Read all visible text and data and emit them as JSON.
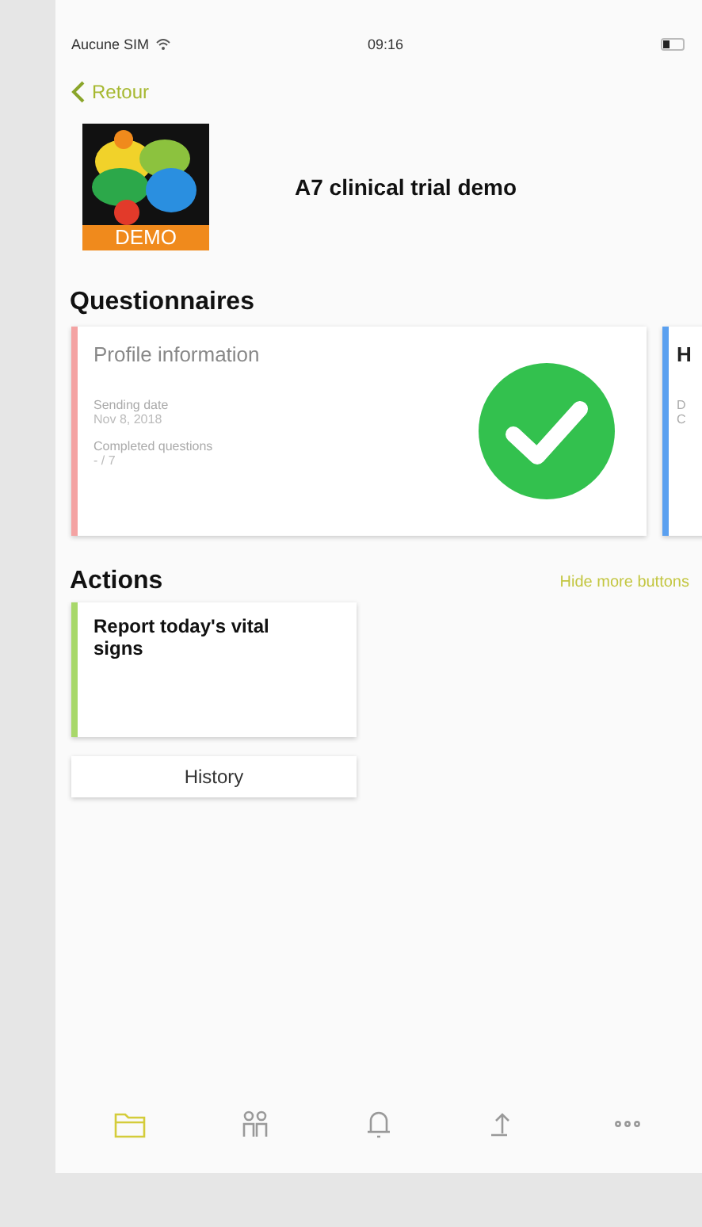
{
  "status_bar": {
    "carrier": "Aucune SIM",
    "time": "09:16"
  },
  "nav": {
    "back": "Retour"
  },
  "study": {
    "title": "A7 clinical trial demo",
    "logo_badge": "DEMO"
  },
  "questionnaires": {
    "heading": "Questionnaires",
    "cards": [
      {
        "title": "Profile information",
        "color": "#f4a3a3",
        "completed": true,
        "fields": [
          {
            "label": "Sending date",
            "value": "Nov 8, 2018"
          },
          {
            "label": "Completed questions",
            "value": "- / 7"
          }
        ]
      },
      {
        "title": "H",
        "color": "#5aa0f0",
        "fields": [
          {
            "label": "D"
          },
          {
            "label": "C"
          }
        ]
      }
    ]
  },
  "actions": {
    "heading": "Actions",
    "toggle": "Hide more buttons",
    "cards": [
      {
        "title": "Report today's vital signs",
        "color": "#a8d86a"
      }
    ],
    "history": "History"
  },
  "tab_bar": [
    {
      "selected": true
    },
    {
      "selected": false
    },
    {
      "selected": false
    },
    {
      "selected": false
    },
    {
      "selected": false
    }
  ]
}
